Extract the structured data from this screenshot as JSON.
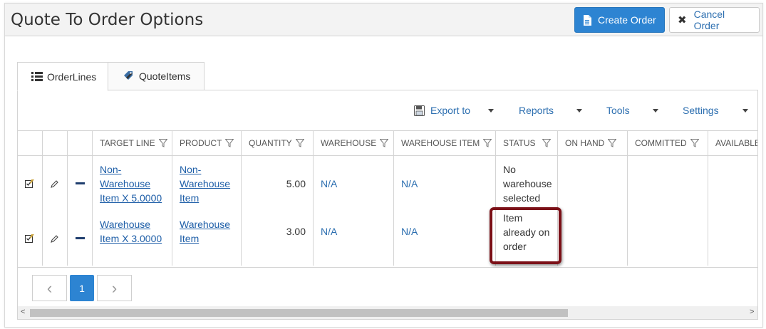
{
  "window": {
    "title": "Quote To Order Options"
  },
  "actions": {
    "create_order": "Create Order",
    "cancel_order": "Cancel Order"
  },
  "tabs": [
    {
      "label": "OrderLines",
      "icon": "list-icon",
      "active": true
    },
    {
      "label": "QuoteItems",
      "icon": "tags-icon",
      "active": false
    }
  ],
  "toolbar": {
    "export_to": "Export to",
    "reports": "Reports",
    "tools": "Tools",
    "settings": "Settings"
  },
  "columns": [
    "TARGET LINE",
    "PRODUCT",
    "QUANTITY",
    "WAREHOUSE",
    "WAREHOUSE ITEM",
    "STATUS",
    "ON HAND",
    "COMMITTED",
    "AVAILABLE"
  ],
  "rows": [
    {
      "target_line": [
        "Non-",
        "Warehouse",
        "Item X 5.0000"
      ],
      "product": [
        "Non-",
        "Warehouse",
        "Item"
      ],
      "quantity": "5.00",
      "warehouse": "N/A",
      "warehouse_item": "N/A",
      "status": [
        "No",
        "warehouse",
        "selected"
      ],
      "on_hand": "",
      "committed": "",
      "available": ""
    },
    {
      "target_line": [
        "Warehouse",
        "Item X 3.0000"
      ],
      "product": [
        "Warehouse",
        "Item"
      ],
      "quantity": "3.00",
      "warehouse": "N/A",
      "warehouse_item": "N/A",
      "status": [
        "Item",
        "already on",
        "order"
      ],
      "on_hand": "",
      "committed": "",
      "available": ""
    }
  ],
  "pager": {
    "current_page": "1",
    "prev_glyph": "‹",
    "next_glyph": "›"
  },
  "scrollbar": {
    "left_glyph": "<",
    "right_glyph": ">"
  },
  "colors": {
    "primary": "#2d84d2",
    "link": "#1f5fa8",
    "highlight": "#7b1017"
  }
}
